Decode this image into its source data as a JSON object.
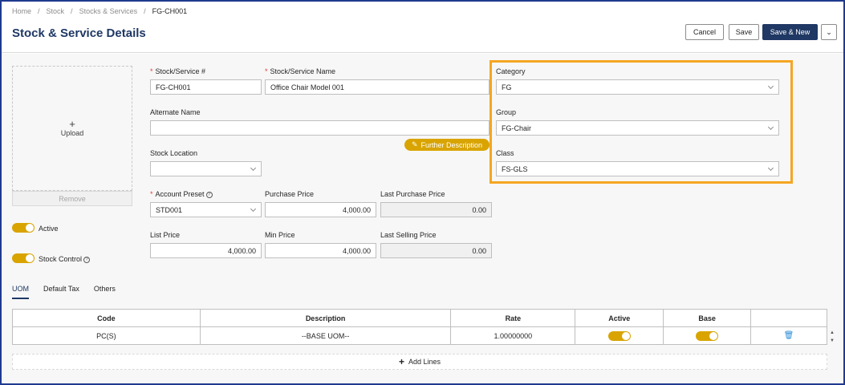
{
  "breadcrumb": [
    "Home",
    "Stock",
    "Stocks & Services",
    "FG-CH001"
  ],
  "page_title": "Stock & Service Details",
  "buttons": {
    "cancel": "Cancel",
    "save": "Save",
    "save_new": "Save & New",
    "more": "⌄"
  },
  "upload": {
    "plus": "+",
    "label": "Upload",
    "remove": "Remove"
  },
  "toggles": {
    "active_label": "Active",
    "active_on": true,
    "stock_control_label": "Stock Control",
    "stock_control_on": true
  },
  "form": {
    "stock_no_label": "Stock/Service #",
    "stock_no_value": "FG-CH001",
    "stock_name_label": "Stock/Service Name",
    "stock_name_value": "Office Chair Model 001",
    "alt_name_label": "Alternate Name",
    "alt_name_value": "",
    "stock_location_label": "Stock Location",
    "stock_location_value": "",
    "further_description": "Further Description",
    "account_preset_label": "Account Preset",
    "account_preset_value": "STD001",
    "purchase_price_label": "Purchase Price",
    "purchase_price_value": "4,000.00",
    "last_purchase_price_label": "Last Purchase Price",
    "last_purchase_price_value": "0.00",
    "list_price_label": "List Price",
    "list_price_value": "4,000.00",
    "min_price_label": "Min Price",
    "min_price_value": "4,000.00",
    "last_selling_price_label": "Last Selling Price",
    "last_selling_price_value": "0.00",
    "category_label": "Category",
    "category_value": "FG",
    "group_label": "Group",
    "group_value": "FG-Chair",
    "class_label": "Class",
    "class_value": "FS-GLS"
  },
  "tabs": [
    "UOM",
    "Default Tax",
    "Others"
  ],
  "uom_table": {
    "headers": [
      "Code",
      "Description",
      "Rate",
      "Active",
      "Base",
      ""
    ],
    "rows": [
      {
        "code": "PC(S)",
        "description": "--BASE UOM--",
        "rate": "1.00000000",
        "active": true,
        "base": true
      }
    ]
  },
  "add_lines": "Add Lines",
  "colors": {
    "accent": "#d9a400",
    "brand": "#1f3864",
    "highlight": "#f5a623"
  }
}
